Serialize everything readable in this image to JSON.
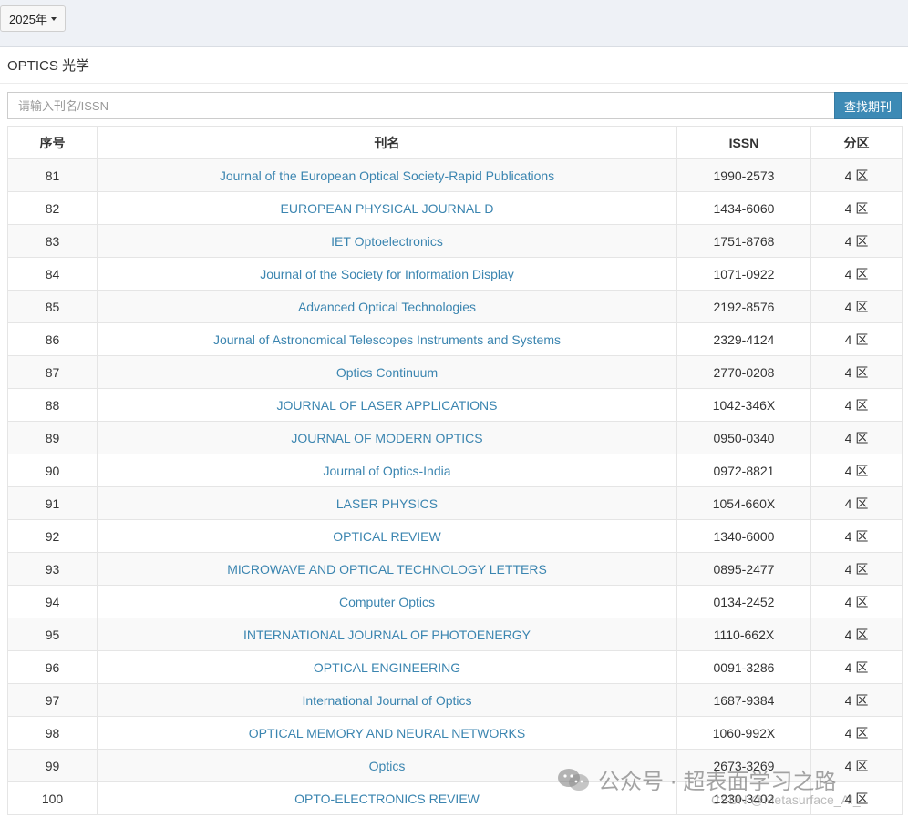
{
  "year_selector": {
    "label": "2025年"
  },
  "page": {
    "title": "OPTICS 光学"
  },
  "search": {
    "placeholder": "请输入刊名/ISSN",
    "button_label": "查找期刊"
  },
  "table": {
    "columns": [
      "序号",
      "刊名",
      "ISSN",
      "分区"
    ],
    "rows": [
      {
        "no": "81",
        "name": "Journal of the European Optical Society-Rapid Publications",
        "issn": "1990-2573",
        "zone": "4 区"
      },
      {
        "no": "82",
        "name": "EUROPEAN PHYSICAL JOURNAL D",
        "issn": "1434-6060",
        "zone": "4 区"
      },
      {
        "no": "83",
        "name": "IET Optoelectronics",
        "issn": "1751-8768",
        "zone": "4 区"
      },
      {
        "no": "84",
        "name": "Journal of the Society for Information Display",
        "issn": "1071-0922",
        "zone": "4 区"
      },
      {
        "no": "85",
        "name": "Advanced Optical Technologies",
        "issn": "2192-8576",
        "zone": "4 区"
      },
      {
        "no": "86",
        "name": "Journal of Astronomical Telescopes Instruments and Systems",
        "issn": "2329-4124",
        "zone": "4 区"
      },
      {
        "no": "87",
        "name": "Optics Continuum",
        "issn": "2770-0208",
        "zone": "4 区"
      },
      {
        "no": "88",
        "name": "JOURNAL OF LASER APPLICATIONS",
        "issn": "1042-346X",
        "zone": "4 区"
      },
      {
        "no": "89",
        "name": "JOURNAL OF MODERN OPTICS",
        "issn": "0950-0340",
        "zone": "4 区"
      },
      {
        "no": "90",
        "name": "Journal of Optics-India",
        "issn": "0972-8821",
        "zone": "4 区"
      },
      {
        "no": "91",
        "name": "LASER PHYSICS",
        "issn": "1054-660X",
        "zone": "4 区"
      },
      {
        "no": "92",
        "name": "OPTICAL REVIEW",
        "issn": "1340-6000",
        "zone": "4 区"
      },
      {
        "no": "93",
        "name": "MICROWAVE AND OPTICAL TECHNOLOGY LETTERS",
        "issn": "0895-2477",
        "zone": "4 区"
      },
      {
        "no": "94",
        "name": "Computer Optics",
        "issn": "0134-2452",
        "zone": "4 区"
      },
      {
        "no": "95",
        "name": "INTERNATIONAL JOURNAL OF PHOTOENERGY",
        "issn": "1110-662X",
        "zone": "4 区"
      },
      {
        "no": "96",
        "name": "OPTICAL ENGINEERING",
        "issn": "0091-3286",
        "zone": "4 区"
      },
      {
        "no": "97",
        "name": "International Journal of Optics",
        "issn": "1687-9384",
        "zone": "4 区"
      },
      {
        "no": "98",
        "name": "OPTICAL MEMORY AND NEURAL NETWORKS",
        "issn": "1060-992X",
        "zone": "4 区"
      },
      {
        "no": "99",
        "name": "Optics",
        "issn": "2673-3269",
        "zone": "4 区"
      },
      {
        "no": "100",
        "name": "OPTO-ELECTRONICS REVIEW",
        "issn": "1230-3402",
        "zone": "4 区"
      }
    ]
  },
  "watermark": {
    "account": "公众号 · 超表面学习之路",
    "source": "CSDN @Metasurface_AI_",
    "icon": "wechat-icon"
  },
  "colors": {
    "link": "#3b85b0",
    "button": "#3d8ab5",
    "topbar": "#eef1f6"
  }
}
